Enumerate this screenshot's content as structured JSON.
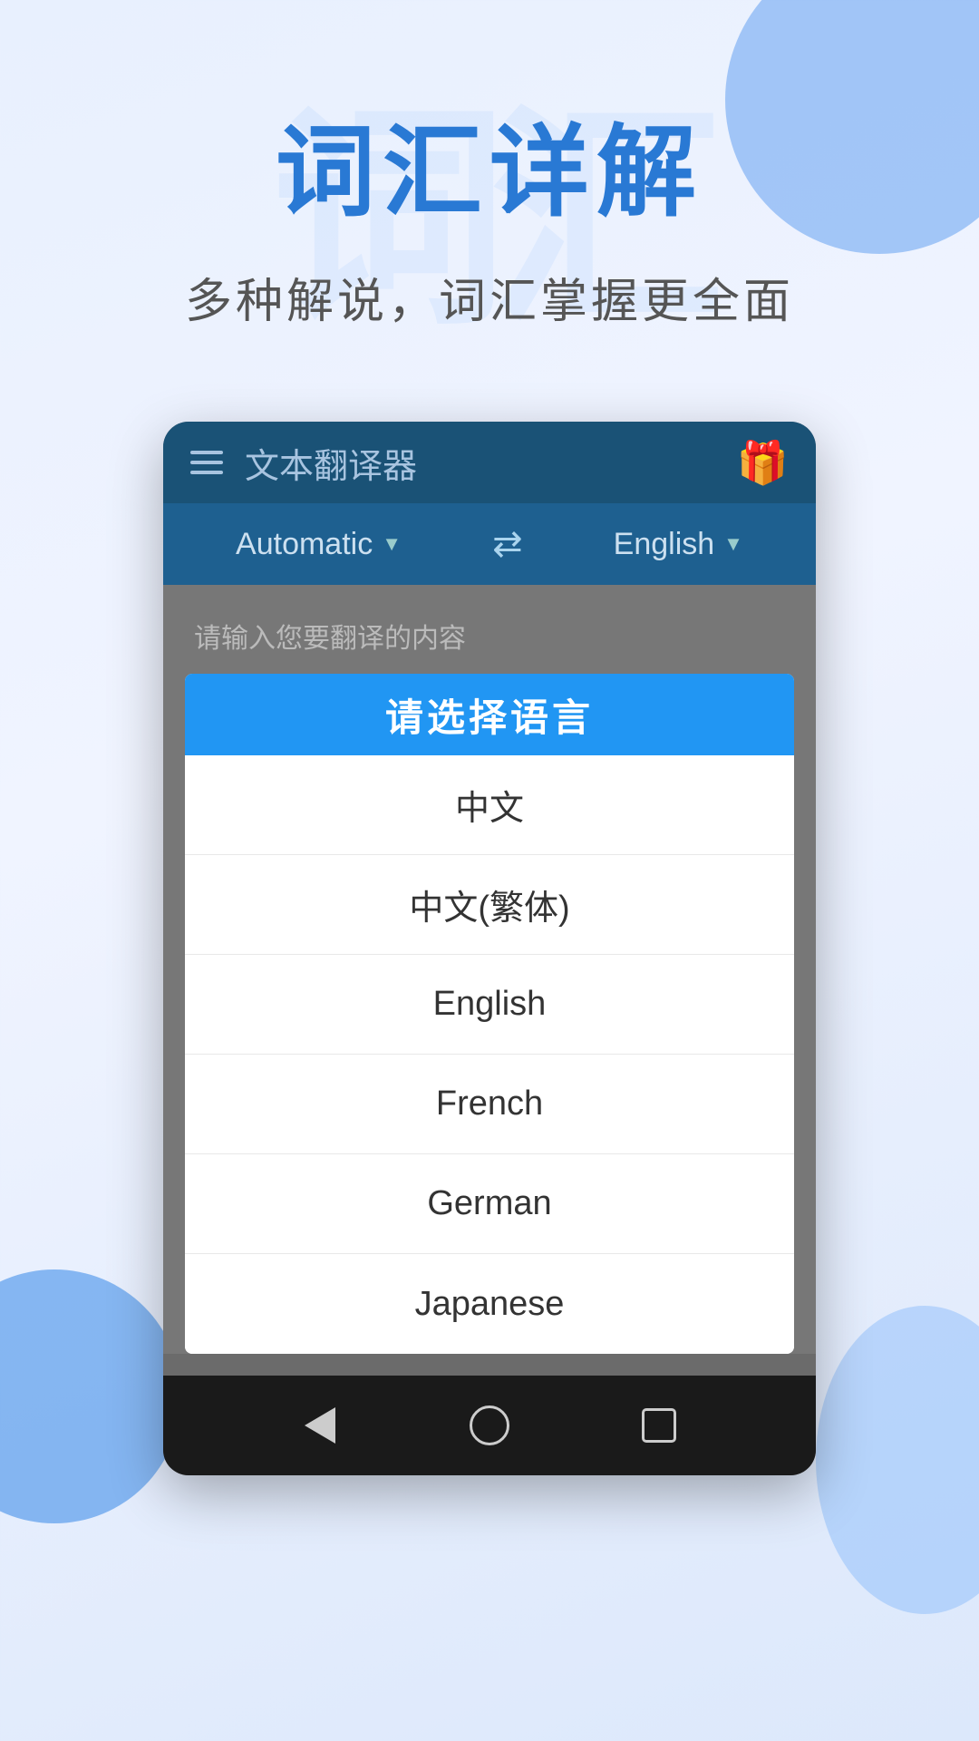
{
  "page": {
    "title": "词汇详解",
    "subtitle": "多种解说，词汇掌握更全面",
    "watermark": "词汇"
  },
  "toolbar": {
    "title": "文本翻译器",
    "hamburger_label": "menu",
    "gift_icon": "🎁"
  },
  "lang_bar": {
    "source_lang": "Automatic",
    "swap_icon": "⇄",
    "target_lang": "English"
  },
  "input": {
    "placeholder": "请输入您要翻译的内容"
  },
  "dialog": {
    "header": "请选择语言",
    "languages": [
      {
        "id": "zh",
        "label": "中文"
      },
      {
        "id": "zh-tw",
        "label": "中文(繁体)"
      },
      {
        "id": "en",
        "label": "English"
      },
      {
        "id": "fr",
        "label": "French"
      },
      {
        "id": "de",
        "label": "German"
      },
      {
        "id": "ja",
        "label": "Japanese"
      }
    ]
  },
  "nav": {
    "back_label": "back",
    "home_label": "home",
    "recents_label": "recents"
  },
  "colors": {
    "accent_blue": "#2979d4",
    "dialog_blue": "#2196f3",
    "toolbar_dark": "#1a5276",
    "toolbar_mid": "#1e6090"
  }
}
